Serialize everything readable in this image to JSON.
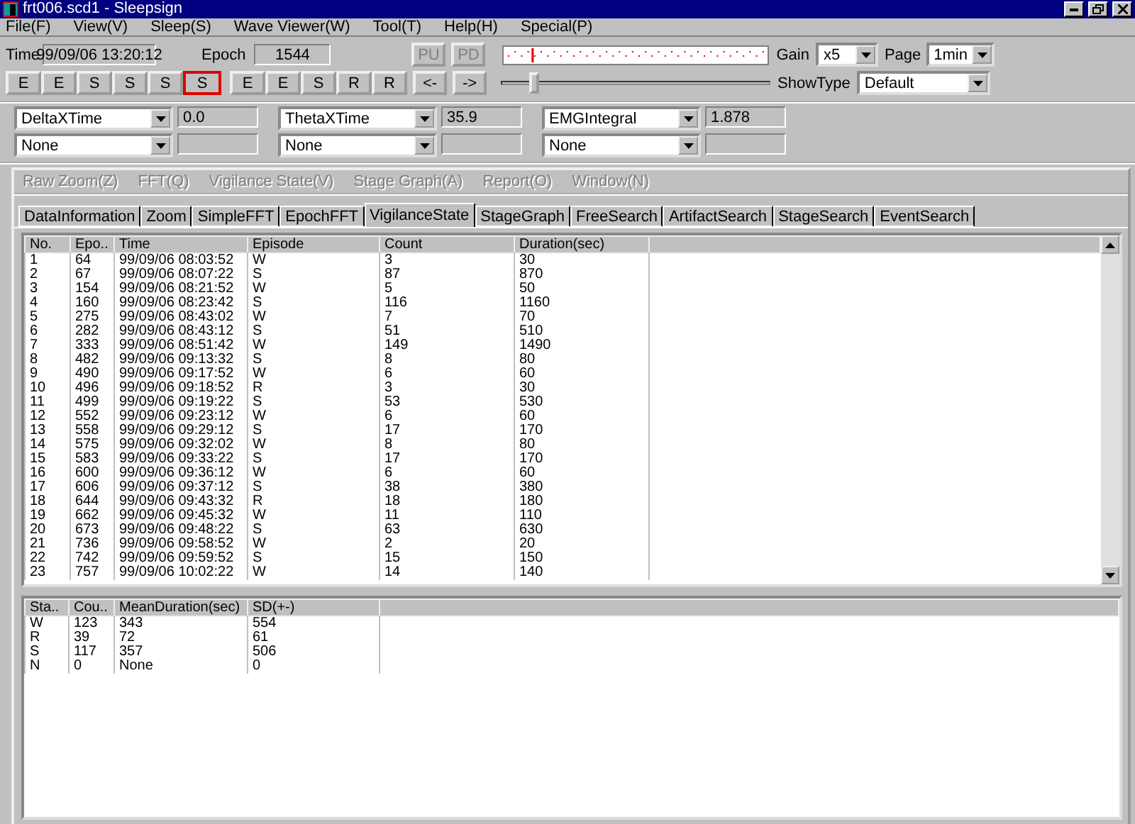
{
  "window": {
    "title": "frt006.scd1 - Sleepsign"
  },
  "menu": [
    "File(F)",
    "View(V)",
    "Sleep(S)",
    "Wave Viewer(W)",
    "Tool(T)",
    "Help(H)",
    "Special(P)"
  ],
  "toolbar": {
    "time_label": "Time",
    "time": "99/09/06  13:20:12",
    "epoch_label": "Epoch",
    "epoch": "1544",
    "stage_buttons": [
      {
        "label": "E",
        "selected": false
      },
      {
        "label": "E",
        "selected": false
      },
      {
        "label": "S",
        "selected": false
      },
      {
        "label": "S",
        "selected": false
      },
      {
        "label": "S",
        "selected": false
      },
      {
        "label": "S",
        "selected": true
      },
      {
        "label": "E",
        "selected": false
      },
      {
        "label": "E",
        "selected": false
      },
      {
        "label": "S",
        "selected": false
      },
      {
        "label": "R",
        "selected": false
      },
      {
        "label": "R",
        "selected": false
      }
    ],
    "page_buttons": [
      {
        "label": "PU",
        "disabled": true
      },
      {
        "label": "PD",
        "disabled": true
      }
    ],
    "nav_buttons": [
      "<-",
      "->"
    ],
    "slider": {
      "level": 0.11
    },
    "gain_label": "Gain",
    "gain": "x5",
    "page_label": "Page",
    "page": "1min",
    "showtype_label": "ShowType",
    "showtype": "Default"
  },
  "parameters": [
    {
      "name": "DeltaXTime",
      "value": "0.0"
    },
    {
      "name": "ThetaXTime",
      "value": "35.9"
    },
    {
      "name": "EMGIntegral",
      "value": "1.878"
    },
    {
      "name": "None"
    },
    {
      "name": "None"
    },
    {
      "name": "None"
    }
  ],
  "child_menu": [
    {
      "label": "Raw Zoom(Z)",
      "disabled": true
    },
    {
      "label": "FFT(Q)",
      "disabled": true
    },
    {
      "label": "Vigilance State(V)",
      "disabled": true
    },
    {
      "label": "Stage Graph(A)",
      "disabled": true
    },
    {
      "label": "Report(O)",
      "disabled": true
    },
    {
      "label": "Window(N)",
      "disabled": true
    }
  ],
  "tabs": [
    {
      "label": "DataInformation",
      "selected": false
    },
    {
      "label": "Zoom",
      "selected": false
    },
    {
      "label": "SimpleFFT",
      "selected": false
    },
    {
      "label": "EpochFFT",
      "selected": false
    },
    {
      "label": "VigilanceState",
      "selected": true
    },
    {
      "label": "StageGraph",
      "selected": false
    },
    {
      "label": "FreeSearch",
      "selected": false
    },
    {
      "label": "ArtifactSearch",
      "selected": false
    },
    {
      "label": "StageSearch",
      "selected": false
    },
    {
      "label": "EventSearch",
      "selected": false
    }
  ],
  "episodes": {
    "columns": [
      "No.",
      "Epo..",
      "Time",
      "Episode",
      "Count",
      "Duration(sec)"
    ],
    "rows": [
      [
        "1",
        "64",
        "99/09/06  08:03:52",
        "W",
        "3",
        "30"
      ],
      [
        "2",
        "67",
        "99/09/06  08:07:22",
        "S",
        "87",
        "870"
      ],
      [
        "3",
        "154",
        "99/09/06  08:21:52",
        "W",
        "5",
        "50"
      ],
      [
        "4",
        "160",
        "99/09/06  08:23:42",
        "S",
        "116",
        "1160"
      ],
      [
        "5",
        "275",
        "99/09/06  08:43:02",
        "W",
        "7",
        "70"
      ],
      [
        "6",
        "282",
        "99/09/06  08:43:12",
        "S",
        "51",
        "510"
      ],
      [
        "7",
        "333",
        "99/09/06  08:51:42",
        "W",
        "149",
        "1490"
      ],
      [
        "8",
        "482",
        "99/09/06  09:13:32",
        "S",
        "8",
        "80"
      ],
      [
        "9",
        "490",
        "99/09/06  09:17:52",
        "W",
        "6",
        "60"
      ],
      [
        "10",
        "496",
        "99/09/06  09:18:52",
        "R",
        "3",
        "30"
      ],
      [
        "11",
        "499",
        "99/09/06  09:19:22",
        "S",
        "53",
        "530"
      ],
      [
        "12",
        "552",
        "99/09/06  09:23:12",
        "W",
        "6",
        "60"
      ],
      [
        "13",
        "558",
        "99/09/06  09:29:12",
        "S",
        "17",
        "170"
      ],
      [
        "14",
        "575",
        "99/09/06  09:32:02",
        "W",
        "8",
        "80"
      ],
      [
        "15",
        "583",
        "99/09/06  09:33:22",
        "S",
        "17",
        "170"
      ],
      [
        "16",
        "600",
        "99/09/06  09:36:12",
        "W",
        "6",
        "60"
      ],
      [
        "17",
        "606",
        "99/09/06  09:37:12",
        "S",
        "38",
        "380"
      ],
      [
        "18",
        "644",
        "99/09/06  09:43:32",
        "R",
        "18",
        "180"
      ],
      [
        "19",
        "662",
        "99/09/06  09:45:32",
        "W",
        "11",
        "110"
      ],
      [
        "20",
        "673",
        "99/09/06  09:48:22",
        "S",
        "63",
        "630"
      ],
      [
        "21",
        "736",
        "99/09/06  09:58:52",
        "W",
        "2",
        "20"
      ],
      [
        "22",
        "742",
        "99/09/06  09:59:52",
        "S",
        "15",
        "150"
      ],
      [
        "23",
        "757",
        "99/09/06  10:02:22",
        "W",
        "14",
        "140"
      ]
    ]
  },
  "summary": {
    "columns": [
      "Sta..",
      "Cou..",
      "MeanDuration(sec)",
      "SD(+-)"
    ],
    "rows": [
      [
        "W",
        "123",
        "343",
        "554"
      ],
      [
        "R",
        "39",
        "72",
        "61"
      ],
      [
        "S",
        "117",
        "357",
        "506"
      ],
      [
        "N",
        "0",
        "None",
        "0"
      ]
    ]
  }
}
